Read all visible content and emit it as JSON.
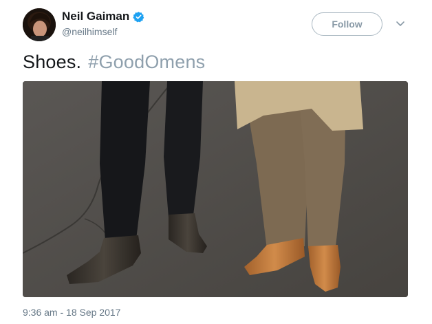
{
  "author": {
    "name": "Neil Gaiman",
    "handle": "@neilhimself",
    "verified": true
  },
  "actions": {
    "follow_label": "Follow",
    "menu_icon": "chevron-down-icon"
  },
  "tweet": {
    "text": "Shoes.",
    "hashtag": "#GoodOmens",
    "timestamp": "9:36 am - 18 Sep 2017"
  },
  "colors": {
    "text": "#14171a",
    "secondary": "#657786",
    "hashtag": "#8fa0ad",
    "verified": "#1da1f2",
    "border": "#aab8c2"
  }
}
